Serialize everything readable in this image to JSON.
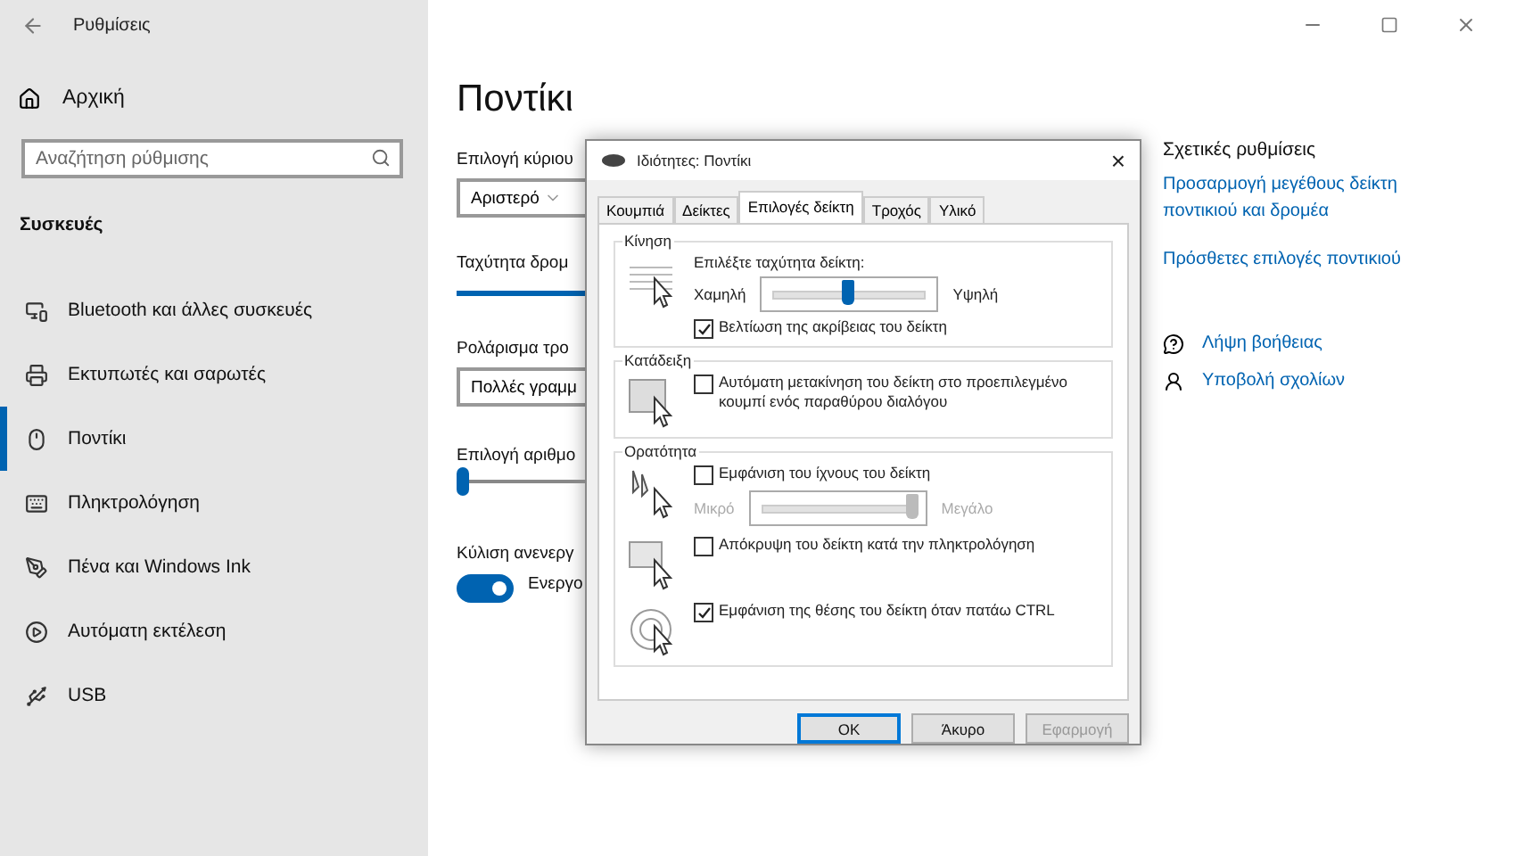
{
  "window": {
    "title": "Ρυθμίσεις"
  },
  "sidebar": {
    "home": "Αρχική",
    "search": {
      "placeholder": "Αναζήτηση ρύθμισης"
    },
    "section": "Συσκευές",
    "items": [
      {
        "label": "Bluetooth και άλλες συσκευές",
        "selected": false
      },
      {
        "label": "Εκτυπωτές και σαρωτές",
        "selected": false
      },
      {
        "label": "Ποντίκι",
        "selected": true
      },
      {
        "label": "Πληκτρολόγηση",
        "selected": false
      },
      {
        "label": "Πένα και Windows Ink",
        "selected": false
      },
      {
        "label": "Αυτόματη εκτέλεση",
        "selected": false
      },
      {
        "label": "USB",
        "selected": false
      }
    ]
  },
  "main": {
    "heading": "Ποντίκι",
    "primary_button": {
      "label": "Επιλογή κύριου",
      "value": "Αριστερό"
    },
    "cursor_speed": {
      "label": "Ταχύτητα δρομ"
    },
    "scroll": {
      "label": "Ρολάρισμα τρο",
      "value": "Πολλές γραμμ"
    },
    "lines": {
      "label": "Επιλογή αριθμο",
      "level": 0
    },
    "inactive_scroll": {
      "label": "Κύλιση ανενεργ",
      "on": true,
      "state": "Ενεργο"
    }
  },
  "dialog": {
    "title": "Ιδιότητες: Ποντίκι",
    "close": "×",
    "tabs": [
      {
        "label": "Κουμπιά",
        "selected": false
      },
      {
        "label": "Δείκτες",
        "selected": false
      },
      {
        "label": "Επιλογές δείκτη",
        "selected": true
      },
      {
        "label": "Τροχός",
        "selected": false
      },
      {
        "label": "Υλικό",
        "selected": false
      }
    ],
    "groups": [
      {
        "title": "Κίνηση",
        "items": [
          {
            "rows": [
              {
                "kind": "text",
                "label": "Επιλέξτε ταχύτητα δείκτη:"
              },
              {
                "kind": "slider",
                "min_label": "Χαμηλή",
                "max_label": "Υψηλή",
                "level": 0.5,
                "disabled": false
              },
              {
                "kind": "checkbox",
                "label": "Βελτίωση της ακρίβειας του δείκτη",
                "checked": true
              }
            ]
          }
        ]
      },
      {
        "title": "Κατάδειξη",
        "items": [
          {
            "rows": [
              {
                "kind": "checkbox",
                "label": "Αυτόματη μετακίνηση του δείκτη στο προεπιλεγμένο κουμπί ενός παραθύρου διαλόγου",
                "checked": false
              }
            ]
          }
        ]
      },
      {
        "title": "Ορατότητα",
        "items": [
          {
            "rows": [
              {
                "kind": "checkbox",
                "label": "Εμφάνιση του ίχνους του δείκτη",
                "checked": false
              },
              {
                "kind": "slider",
                "min_label": "Μικρό",
                "max_label": "Μεγάλο",
                "level": 1,
                "disabled": true
              }
            ]
          },
          {
            "rows": [
              {
                "kind": "checkbox",
                "label": "Απόκρυψη του δείκτη κατά την πληκτρολόγηση",
                "checked": false
              }
            ]
          },
          {
            "rows": [
              {
                "kind": "checkbox",
                "label": "Εμφάνιση της θέσης του δείκτη όταν πατάω CTRL",
                "checked": true
              }
            ]
          }
        ]
      }
    ],
    "buttons": [
      {
        "label": "OK",
        "default": true,
        "disabled": false
      },
      {
        "label": "Άκυρο",
        "default": false,
        "disabled": false
      },
      {
        "label": "Εφαρμογή",
        "default": false,
        "disabled": true
      }
    ]
  },
  "related": {
    "title": "Σχετικές ρυθμίσεις",
    "links": [
      "Προσαρμογή μεγέθους δείκτη ποντικιού και δρομέα",
      "Πρόσθετες επιλογές ποντικιού"
    ]
  },
  "help": [
    "Λήψη βοήθειας",
    "Υποβολή σχολίων"
  ]
}
